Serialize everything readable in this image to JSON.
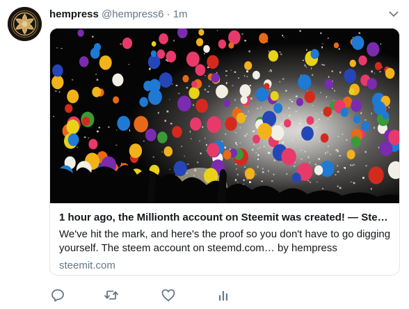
{
  "tweet": {
    "author_name": "hempress",
    "author_handle": "@hempress6",
    "separator": "·",
    "timestamp": "1m"
  },
  "card": {
    "title": "1 hour ago, the Millionth account on Steemit was created! — Steemit",
    "description": "We've hit the mark, and here's the proof so you don't have to go digging yourself. The steem account on steemd.com… by hempress",
    "domain": "steemit.com"
  },
  "icons": {
    "menu": "chevron-down-icon",
    "reply": "reply-icon",
    "retweet": "retweet-icon",
    "like": "heart-icon",
    "analytics": "analytics-icon"
  },
  "colors": {
    "text_primary": "#14171a",
    "text_secondary": "#657786",
    "border": "#e1e8ed",
    "action_icon": "#657786"
  }
}
